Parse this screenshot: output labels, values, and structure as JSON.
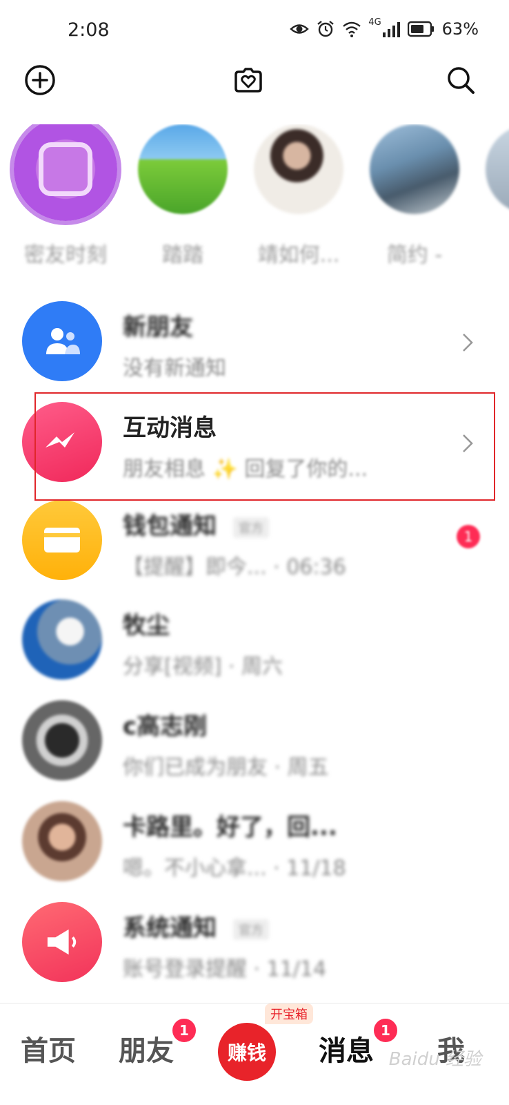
{
  "status_bar": {
    "time": "2:08",
    "network": "4G",
    "battery": "63%"
  },
  "top_bar": {
    "icons": [
      "add-icon",
      "heart-camera-icon",
      "search-icon"
    ]
  },
  "stories": [
    {
      "name": "密友时刻"
    },
    {
      "name": "踏踏"
    },
    {
      "name": "靖如何..."
    },
    {
      "name": "简约 -"
    }
  ],
  "messages": [
    {
      "title": "新朋友",
      "subtitle": "没有新通知"
    },
    {
      "title": "互动消息",
      "subtitle": "朋友相息 ✨ 回复了你的..."
    },
    {
      "title": "钱包通知",
      "tag": "官方",
      "subtitle": "【提醒】即今... · 06:36",
      "badge": "1"
    },
    {
      "title": "牧尘",
      "subtitle": "分享[视频] · 周六"
    },
    {
      "title": "c高志刚",
      "subtitle": "你们已成为朋友 · 周五"
    },
    {
      "title": "卡路里。好了，回...",
      "subtitle": "嗯。不小心拿... · 11/18"
    },
    {
      "title": "系统通知",
      "tag": "官方",
      "subtitle": "账号登录提醒 · 11/14"
    }
  ],
  "bottom_nav": {
    "home": "首页",
    "friends": "朋友",
    "friends_badge": "1",
    "earn": "赚钱",
    "earn_tag": "开宝箱",
    "messages": "消息",
    "messages_badge": "1",
    "me": "我",
    "watermark": "Baidu 经验"
  },
  "colors": {
    "accent_red": "#fe2c55",
    "highlight_border": "#e0262a"
  }
}
